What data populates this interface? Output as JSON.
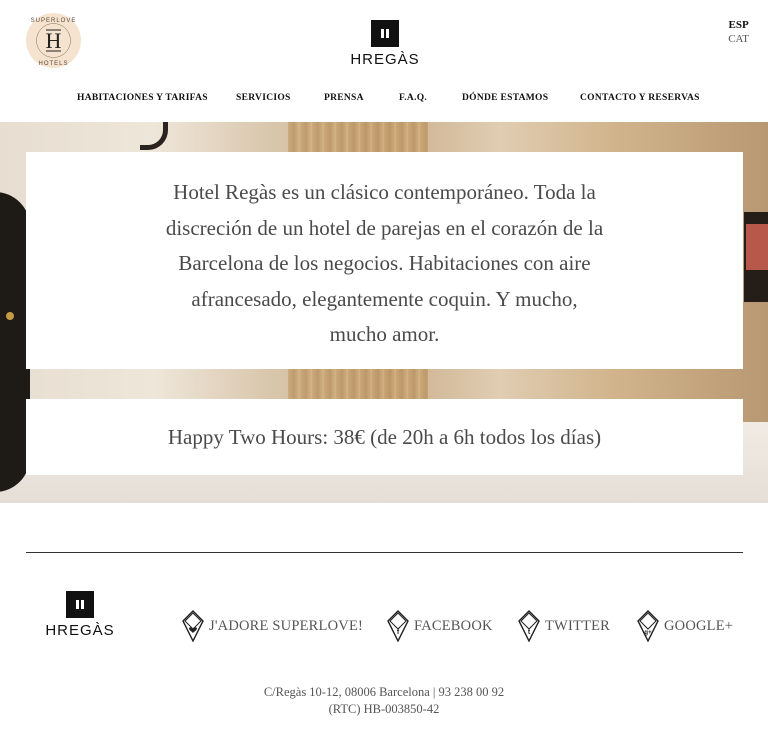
{
  "header": {
    "badge_text": "SUPERLOVEHOTELS",
    "logo_text": "HREGÀS",
    "languages": [
      "ESP",
      "CAT"
    ]
  },
  "nav": {
    "items": [
      "HABITACIONES Y TARIFAS",
      "SERVICIOS",
      "PRENSA",
      "F.A.Q.",
      "DÓNDE ESTAMOS",
      "CONTACTO Y RESERVAS"
    ]
  },
  "hero": {
    "intro_lines": [
      "Hotel Regàs es un clásico contemporáneo. Toda la",
      "discreción de un hotel de parejas en el corazón de la",
      "Barcelona de los negocios. Habitaciones con aire",
      "afrancesado, elegantemente coquin. Y mucho,",
      "mucho amor."
    ],
    "promo": "Happy Two Hours: 38€ (de 20h a 6h todos los días)"
  },
  "footer": {
    "logo_text": "HREGÀS",
    "social": [
      {
        "label": "J'ADORE SUPERLOVE!",
        "icon": "heart-diamond-icon"
      },
      {
        "label": "FACEBOOK",
        "icon": "facebook-icon"
      },
      {
        "label": "TWITTER",
        "icon": "twitter-icon"
      },
      {
        "label": "GOOGLE+",
        "icon": "google-plus-icon"
      }
    ],
    "address": "C/Regàs 10-12, 08006 Barcelona | 93 238 00 92",
    "registry": "(RTC) HB-003850-42"
  }
}
